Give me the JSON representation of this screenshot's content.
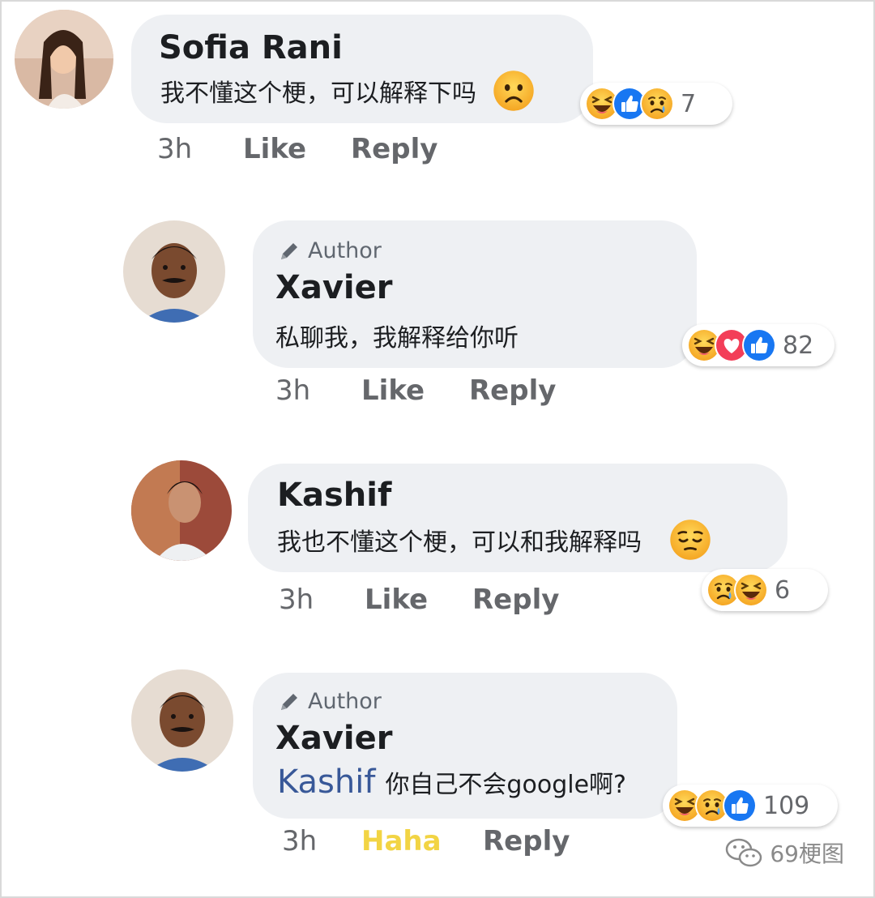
{
  "comments": [
    {
      "name": "Sofia Rani",
      "text": "我不懂这个梗，可以解释下吗",
      "time": "3h",
      "like": "Like",
      "reply": "Reply",
      "reaction_count": "7",
      "reactions": [
        "haha-icon",
        "like-icon",
        "sad-icon"
      ],
      "emoji": "frowning-face-icon"
    },
    {
      "author_badge": "Author",
      "name": "Xavier",
      "text": "私聊我，我解释给你听",
      "time": "3h",
      "like": "Like",
      "reply": "Reply",
      "reaction_count": "82",
      "reactions": [
        "haha-icon",
        "love-icon",
        "like-icon"
      ]
    },
    {
      "name": "Kashif",
      "text": "我也不懂这个梗，可以和我解释吗",
      "time": "3h",
      "like": "Like",
      "reply": "Reply",
      "reaction_count": "6",
      "reactions": [
        "sad-icon",
        "haha-icon"
      ],
      "emoji": "pensive-face-icon"
    },
    {
      "author_badge": "Author",
      "name": "Xavier",
      "mention": "Kashif",
      "text": "你自己不会google啊?",
      "time": "3h",
      "like": "Haha",
      "reply": "Reply",
      "reaction_count": "109",
      "reactions": [
        "haha-icon",
        "sad-icon",
        "like-icon"
      ]
    }
  ],
  "watermark": "69梗图",
  "colors": {
    "bubble": "#eef0f3",
    "like_blue": "#1877f2",
    "love_red": "#f33e58",
    "haha_yellow": "#f7b125",
    "haha_label": "#f2d444",
    "mention": "#385898"
  }
}
